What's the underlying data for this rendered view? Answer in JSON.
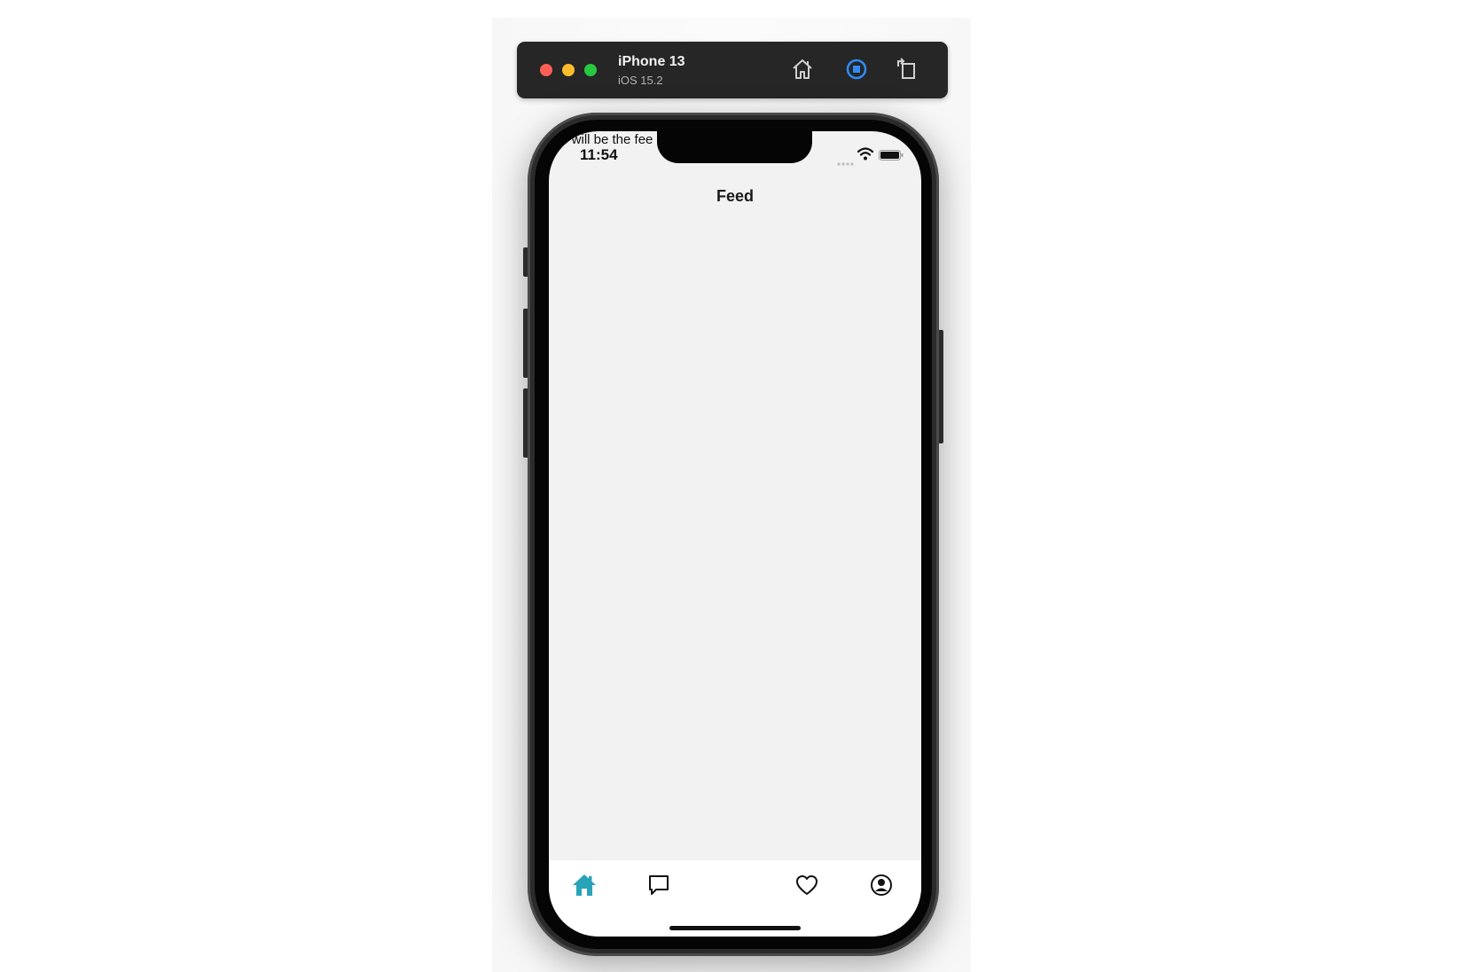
{
  "simulator": {
    "device_name": "iPhone 13",
    "os_version": "iOS 15.2",
    "toolbar_icons": [
      "home-icon",
      "screenshot-icon",
      "rotate-icon"
    ]
  },
  "status_bar": {
    "time": "11:54",
    "icons": [
      "cellular-signal-icon",
      "wifi-icon",
      "battery-icon"
    ]
  },
  "screen": {
    "overflow_text": "s will be the fee",
    "nav_title": "Feed"
  },
  "tab_bar": {
    "active_color": "#2aa3b8",
    "inactive_color": "#111111",
    "tabs": [
      {
        "icon": "home-icon",
        "active": true
      },
      {
        "icon": "chat-bubble-icon",
        "active": false
      },
      {
        "icon": "heart-icon",
        "active": false
      },
      {
        "icon": "profile-icon",
        "active": false
      }
    ]
  }
}
